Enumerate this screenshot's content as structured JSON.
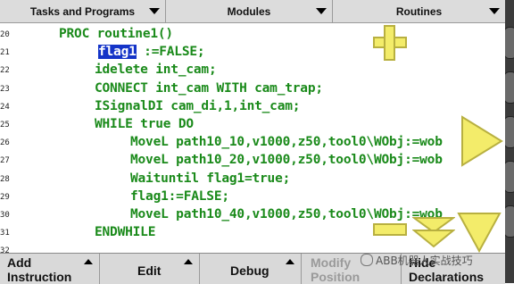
{
  "tabs": [
    {
      "label": "Tasks and Programs"
    },
    {
      "label": "Modules"
    },
    {
      "label": "Routines"
    }
  ],
  "code": {
    "lines": [
      {
        "num": "20",
        "indent": 1,
        "pre": "PROC routine1()",
        "hl": "",
        "post": ""
      },
      {
        "num": "21",
        "indent": 2,
        "pre": "",
        "hl": "flag1",
        "post": " :=FALSE;"
      },
      {
        "num": "22",
        "indent": 2,
        "pre": "idelete int_cam;",
        "hl": "",
        "post": ""
      },
      {
        "num": "23",
        "indent": 2,
        "pre": "CONNECT int_cam WITH cam_trap;",
        "hl": "",
        "post": ""
      },
      {
        "num": "24",
        "indent": 2,
        "pre": "ISignalDI cam_di,1,int_cam;",
        "hl": "",
        "post": ""
      },
      {
        "num": "25",
        "indent": 2,
        "pre": "WHILE true DO",
        "hl": "",
        "post": ""
      },
      {
        "num": "26",
        "indent": 3,
        "pre": "MoveL path10_10,v1000,z50,tool0\\WObj:=wob",
        "hl": "",
        "post": ""
      },
      {
        "num": "27",
        "indent": 3,
        "pre": "MoveL path10_20,v1000,z50,tool0\\WObj:=wob",
        "hl": "",
        "post": ""
      },
      {
        "num": "28",
        "indent": 3,
        "pre": "Waituntil flag1=true;",
        "hl": "",
        "post": ""
      },
      {
        "num": "29",
        "indent": 3,
        "pre": "flag1:=FALSE;",
        "hl": "",
        "post": ""
      },
      {
        "num": "30",
        "indent": 3,
        "pre": "MoveL path10_40,v1000,z50,tool0\\WObj:=wob",
        "hl": "",
        "post": ""
      },
      {
        "num": "31",
        "indent": 2,
        "pre": "ENDWHILE",
        "hl": "",
        "post": ""
      },
      {
        "num": "32",
        "indent": 0,
        "pre": "",
        "hl": "",
        "post": ""
      }
    ]
  },
  "overlay_controls": [
    "plus-icon",
    "play-icon",
    "minus-icon",
    "step-down-icon",
    "step-down-single-icon"
  ],
  "bottom": {
    "buttons": [
      {
        "label": "Add\nInstruction",
        "enabled": true
      },
      {
        "label": "Edit",
        "enabled": true
      },
      {
        "label": "Debug",
        "enabled": true
      },
      {
        "label": "Modify\nPosition",
        "enabled": false
      },
      {
        "label": "Hide\nDeclarations",
        "enabled": true
      }
    ]
  },
  "watermark": "ABB机器人实战技巧",
  "colors": {
    "code": "#1a8a1a",
    "highlight": "#1434c8",
    "control_yellow": "#f3ec6a"
  }
}
